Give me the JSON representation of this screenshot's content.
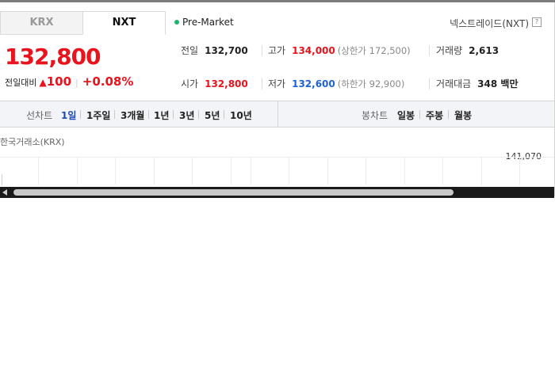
{
  "tabs": {
    "krx": "KRX",
    "nxt": "NXT"
  },
  "session": {
    "label": "Pre-Market",
    "dot_color": "#23b26d"
  },
  "exchange": {
    "name": "넥스트레이드(NXT)",
    "help": "?"
  },
  "price": {
    "current": "132,800",
    "change_label": "전일대비",
    "change_arrow": "▲",
    "change_amount": "100",
    "change_percent": "+0.08%"
  },
  "stats": {
    "prev_close": {
      "label": "전일",
      "value": "132,700"
    },
    "high": {
      "label": "고가",
      "value": "134,000",
      "sub": "(상한가 172,500)"
    },
    "volume": {
      "label": "거래량",
      "value": "2,613"
    },
    "open": {
      "label": "시가",
      "value": "132,800"
    },
    "low": {
      "label": "저가",
      "value": "132,600",
      "sub": "(하한가 92,900)"
    },
    "trade_value": {
      "label": "거래대금",
      "value": "348 백만"
    }
  },
  "periods": {
    "line_label": "선차트",
    "line_items": [
      "1일",
      "1주일",
      "3개월",
      "1년",
      "3년",
      "5년",
      "10년"
    ],
    "active": "1일",
    "candle_label": "봉차트",
    "candle_items": [
      "일봉",
      "주봉",
      "월봉"
    ]
  },
  "chart": {
    "source_label": "한국거래소(KRX)",
    "y_top": "141,070"
  },
  "colors": {
    "up": "#e8131c",
    "down": "#1e63d6",
    "active_period": "#1e49b0"
  }
}
